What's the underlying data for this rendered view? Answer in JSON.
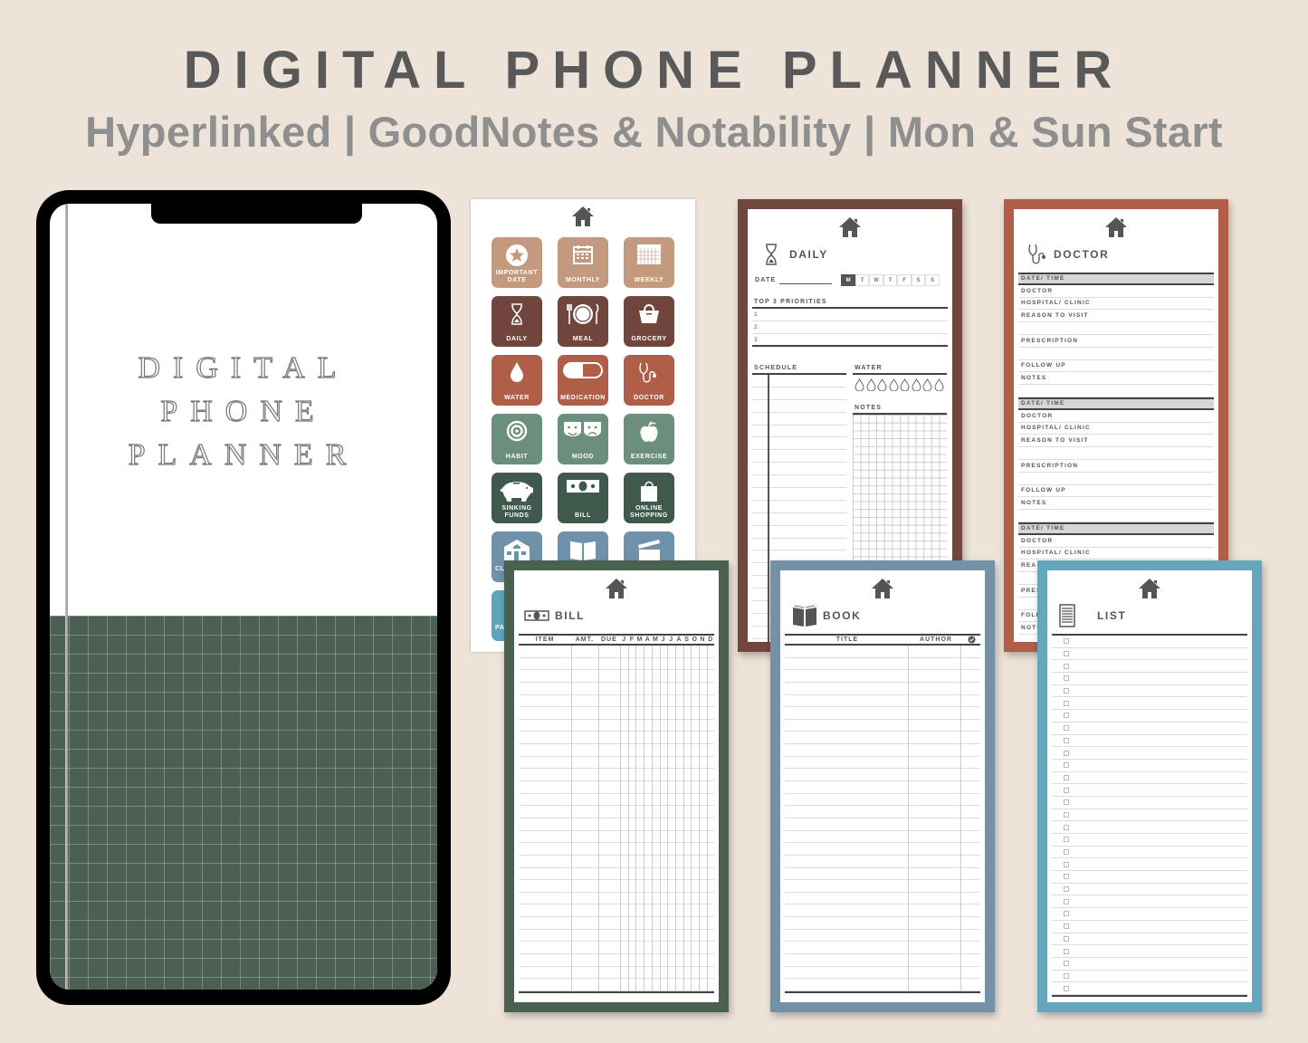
{
  "header": {
    "title": "DIGITAL PHONE PLANNER",
    "subtitle": "Hyperlinked | GoodNotes & Notability | Mon & Sun Start"
  },
  "phone": {
    "cover_lines": [
      "DIGITAL",
      "PHONE",
      "PLANNER"
    ],
    "cover_grid_color": "#4b6052"
  },
  "index_page": {
    "tiles": [
      {
        "label": "IMPORTANT DATE",
        "icon": "star-icon",
        "color": "#c49a7e"
      },
      {
        "label": "MONTHLY",
        "icon": "calendar-icon",
        "color": "#c49a7e"
      },
      {
        "label": "WEEKLY",
        "icon": "weekly-calendar-icon",
        "color": "#c49a7e"
      },
      {
        "label": "DAILY",
        "icon": "hourglass-icon",
        "color": "#70453b"
      },
      {
        "label": "MEAL",
        "icon": "plate-icon",
        "color": "#70453b"
      },
      {
        "label": "GROCERY",
        "icon": "shopping-bag-icon",
        "color": "#70453b"
      },
      {
        "label": "WATER",
        "icon": "water-drop-icon",
        "color": "#b15e48"
      },
      {
        "label": "MEDICATION",
        "icon": "pill-icon",
        "color": "#b15e48"
      },
      {
        "label": "DOCTOR",
        "icon": "stethoscope-icon",
        "color": "#b15e48"
      },
      {
        "label": "HABIT",
        "icon": "target-icon",
        "color": "#6b8e7d"
      },
      {
        "label": "MOOD",
        "icon": "theater-masks-icon",
        "color": "#6b8e7d"
      },
      {
        "label": "EXERCISE",
        "icon": "apple-icon",
        "color": "#6b8e7d"
      },
      {
        "label": "SINKING FUNDS",
        "icon": "piggy-bank-icon",
        "color": "#3f5a4c"
      },
      {
        "label": "BILL",
        "icon": "cash-icon",
        "color": "#3f5a4c"
      },
      {
        "label": "ONLINE SHOPPING",
        "icon": "bag-icon",
        "color": "#3f5a4c"
      },
      {
        "label": "CL",
        "icon": "house-icon",
        "color": "#6f92aa"
      },
      {
        "label": "",
        "icon": "book-icon",
        "color": "#6f92aa"
      },
      {
        "label": "",
        "icon": "clapperboard-icon",
        "color": "#6f92aa"
      },
      {
        "label": "PA",
        "icon": "",
        "color": "#5fa3ba"
      }
    ]
  },
  "daily": {
    "title": "DAILY",
    "border_color": "#71463c",
    "date_label": "DATE",
    "days": [
      "M",
      "T",
      "W",
      "T",
      "F",
      "S",
      "S"
    ],
    "active_day": "M",
    "priorities_label": "TOP 3 PRIORITIES",
    "priorities": [
      "1",
      "2",
      "3"
    ],
    "schedule_label": "SCHEDULE",
    "water_label": "WATER",
    "water_drops": 8,
    "notes_label": "NOTES"
  },
  "doctor": {
    "title": "DOCTOR",
    "border_color": "#b15e48",
    "sections": [
      [
        "DATE/ TIME",
        "DOCTOR",
        "HOSPITAL/ CLINIC",
        "REASON TO VISIT",
        "",
        "PRESCRIPTION",
        "",
        "FOLLOW UP",
        "NOTES",
        ""
      ],
      [
        "DATE/ TIME",
        "DOCTOR",
        "HOSPITAL/ CLINIC",
        "REASON TO VISIT",
        "",
        "PRESCRIPTION",
        "",
        "FOLLOW UP",
        "NOTES",
        ""
      ],
      [
        "DATE/ TIME",
        "DOCTOR",
        "HOSPITAL/ CLINIC",
        "REASON TO VISIT",
        "",
        "PRESCRIPTION",
        "",
        "FOLLOW UP",
        "NOTES"
      ]
    ]
  },
  "bill": {
    "title": "BILL",
    "border_color": "#4a6152",
    "columns": [
      "ITEM",
      "AMT.",
      "DUE"
    ],
    "months": [
      "J",
      "F",
      "M",
      "A",
      "M",
      "J",
      "J",
      "A",
      "S",
      "O",
      "N",
      "D"
    ]
  },
  "book": {
    "title": "BOOK",
    "border_color": "#7492a7",
    "columns": [
      "TITLE",
      "AUTHOR"
    ],
    "check_icon": "check-circle-icon"
  },
  "list": {
    "title": "LIST",
    "border_color": "#66a6bd"
  }
}
